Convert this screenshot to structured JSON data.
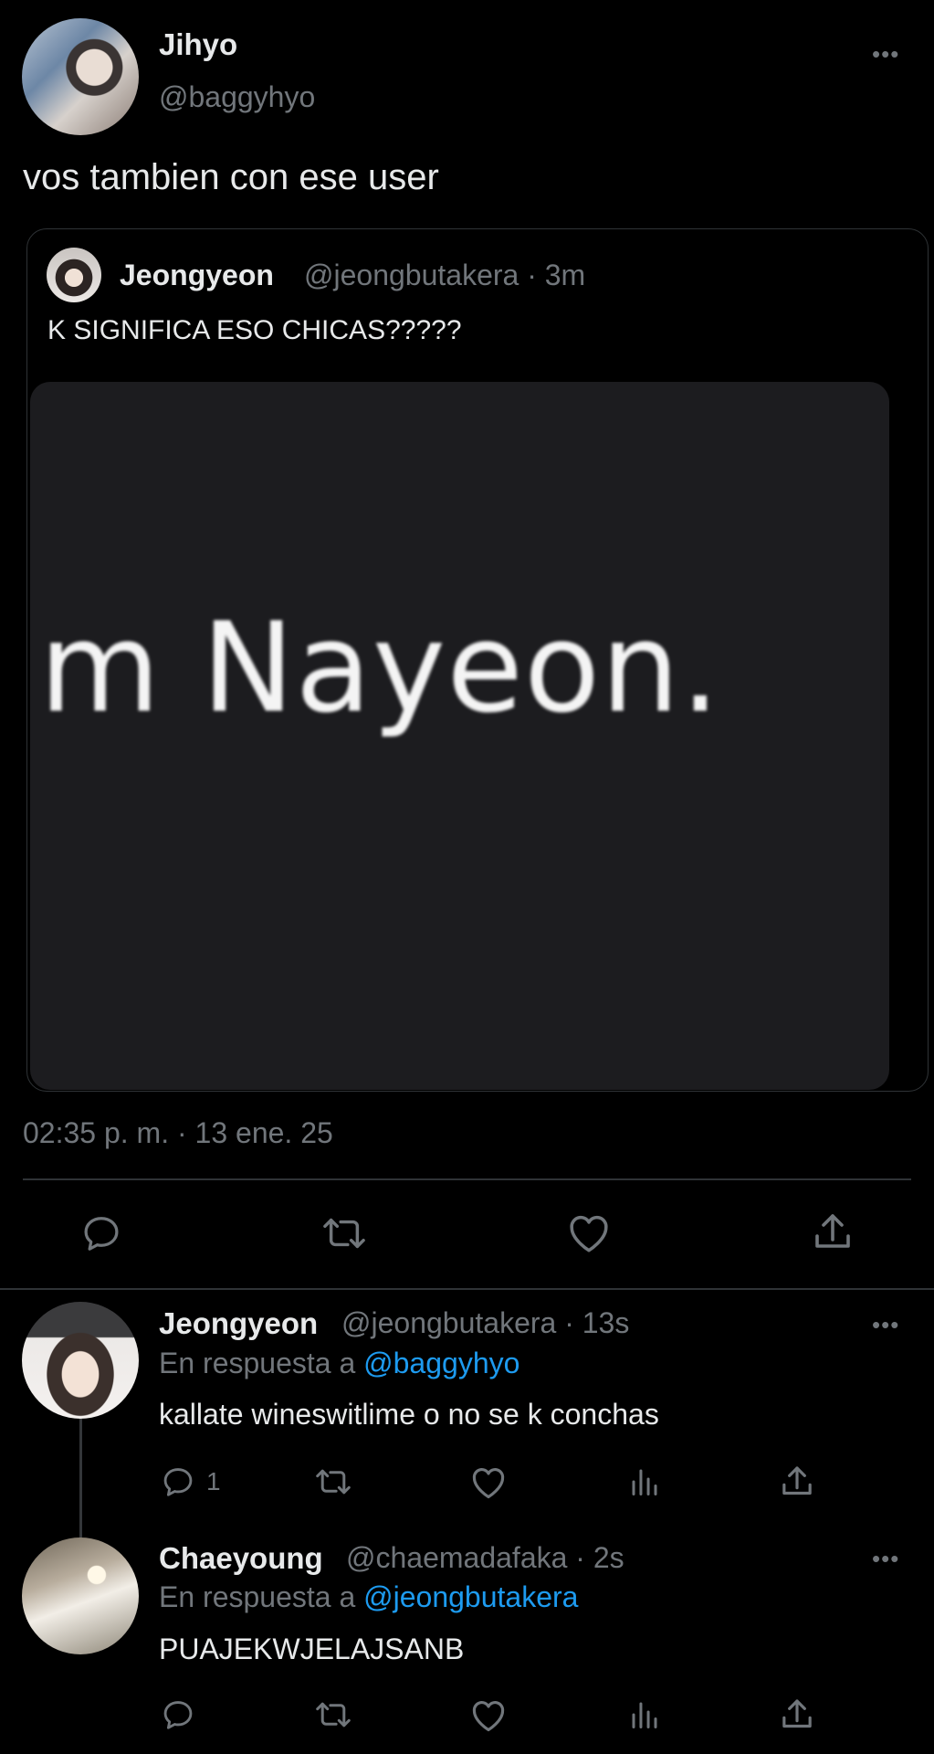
{
  "main_tweet": {
    "name": "Jihyo",
    "handle": "@baggyhyo",
    "text": "vos tambien con ese user",
    "timestamp": "02:35 p. m. · 13 ene. 25"
  },
  "quoted_tweet": {
    "name": "Jeongyeon",
    "handle": "@jeongbutakera",
    "time": "· 3m",
    "text": "K SIGNIFICA ESO CHICAS?????",
    "media_text": "m Nayeon."
  },
  "replies": [
    {
      "name": "Jeongyeon",
      "handle": "@jeongbutakera",
      "time": "· 13s",
      "reply_prefix": "En respuesta a",
      "reply_to": "@baggyhyo",
      "text": "kallate wineswitlime o no se k conchas",
      "reply_count": "1"
    },
    {
      "name": "Chaeyoung",
      "handle": "@chaemadafaka",
      "time": "· 2s",
      "reply_prefix": "En respuesta a",
      "reply_to": "@jeongbutakera",
      "text": "PUAJEKWJELAJSANB",
      "reply_count": ""
    }
  ],
  "icons": {
    "more": "more-horizontal-icon",
    "reply": "reply-icon",
    "retweet": "retweet-icon",
    "like": "heart-icon",
    "views": "views-icon",
    "share": "share-icon"
  },
  "colors": {
    "background": "#000000",
    "text": "#e7e9ea",
    "muted": "#71767b",
    "link": "#1d9bf0",
    "border": "#2f3336"
  }
}
